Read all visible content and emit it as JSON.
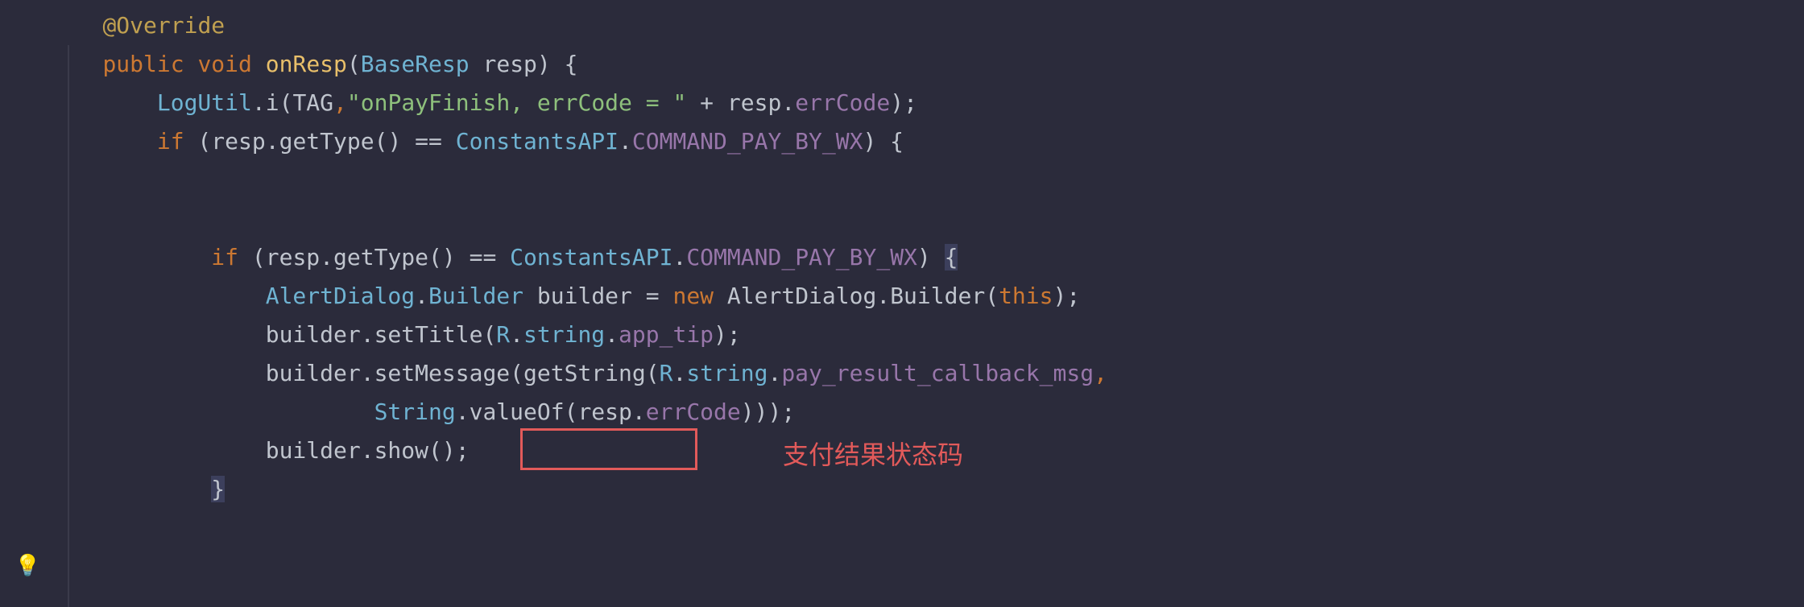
{
  "gutter": {
    "bulb_icon": "💡"
  },
  "code": {
    "l1": {
      "annotation": "@Override"
    },
    "l2": {
      "kw_public": "public",
      "kw_void": "void",
      "method": "onResp",
      "lp": "(",
      "ptype": "BaseResp",
      "pname": " resp",
      "rp": ")",
      "brace": " {"
    },
    "l3": {
      "cls": "LogUtil",
      "dot": ".",
      "call": "i(",
      "arg1": "TAG",
      "comma": ",",
      "str": "\"onPayFinish, errCode = \"",
      "plus": " + resp",
      "dot2": ".",
      "field": "errCode",
      "end": ");"
    },
    "l4": {
      "kw_if": "if",
      "expr1": " (resp.getType() == ",
      "cls": "ConstantsAPI",
      "dot": ".",
      "constant": "COMMAND_PAY_BY_WX",
      "end": ") {"
    },
    "l6": {
      "kw_if": "if",
      "expr1": " (resp.getType() == ",
      "cls": "ConstantsAPI",
      "dot": ".",
      "constant": "COMMAND_PAY_BY_WX",
      "rp": ") ",
      "brace": "{"
    },
    "l7": {
      "type1": "AlertDialog",
      "dot1": ".",
      "type2": "Builder",
      "var": " builder = ",
      "kw_new": "new",
      "sp": " ",
      "ctor1": "AlertDialog",
      "dot2": ".",
      "ctor2": "Builder",
      "lp": "(",
      "kw_this": "this",
      "end": ");"
    },
    "l8": {
      "call": "builder.setTitle(",
      "r": "R",
      "dot1": ".",
      "string_cls": "string",
      "dot2": ".",
      "field": "app_tip",
      "end": ");"
    },
    "l9": {
      "call": "builder.setMessage(getString(",
      "r": "R",
      "dot1": ".",
      "string_cls": "string",
      "dot2": ".",
      "field": "pay_result_callback_msg",
      "comma": ","
    },
    "l10": {
      "cls": "String",
      "call": ".valueOf(",
      "obj": "resp",
      "dot": ".",
      "field": "errCode",
      "end": ")));"
    },
    "l11": {
      "call": "builder.show();"
    },
    "l12": {
      "brace": "}"
    }
  },
  "annotation_label": "支付结果状态码"
}
